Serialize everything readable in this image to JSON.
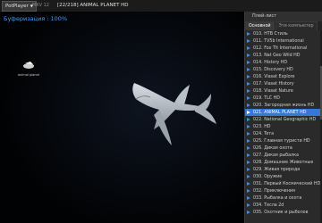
{
  "titlebar": {
    "app_name": "PotPlayer",
    "version": "MKV 12",
    "channel_title": "[22/218] ANIMAL PLANET HD"
  },
  "video": {
    "buffering_text": "Буферизация : 100%",
    "logo_text": "animal planet"
  },
  "playlist": {
    "header": "Плей-лист",
    "tabs": [
      "Основной",
      "Эти компьютер"
    ],
    "active_tab": 0,
    "selected_index": 11,
    "items": [
      "010. НТВ Стиль",
      "011. TV5b International",
      "012. Fox Tlt International",
      "013. Nat Geo Wild HD",
      "014. History HD",
      "015. Discovery HD",
      "016. Viasat Explore",
      "017. Viasat History",
      "018. Viasat Nature",
      "019. TLC HD",
      "020. Загородная жизнь HD",
      "021. ANIMAL PLANET HD",
      "022. National Geographic HD",
      "023. HD",
      "024. Teтa",
      "025. Главная туристи HD",
      "026. Дикая охота",
      "027. Дикая рыбалка",
      "028. Домашние Животные",
      "029. Живая природа",
      "030. Оружие",
      "031. Первый Космический HD",
      "032. Приключения",
      "033. Рыбалка и охота",
      "034. Тесла 2d",
      "035. Охотник и рыболов"
    ]
  }
}
